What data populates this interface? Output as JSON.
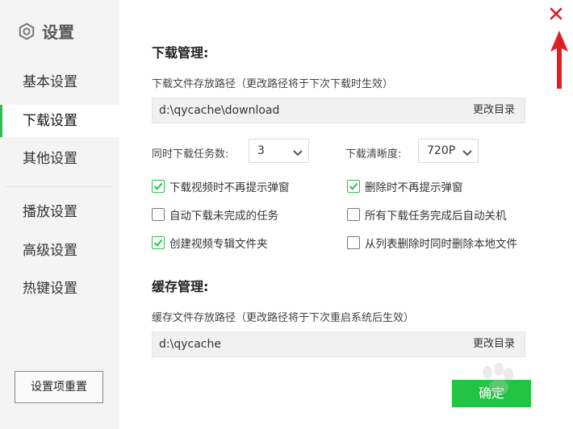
{
  "sidebar": {
    "title": "设置",
    "items": [
      {
        "label": "基本设置",
        "active": false
      },
      {
        "label": "下载设置",
        "active": true
      },
      {
        "label": "其他设置",
        "active": false
      },
      {
        "label": "播放设置",
        "active": false
      },
      {
        "label": "高级设置",
        "active": false
      },
      {
        "label": "热键设置",
        "active": false
      }
    ],
    "reset_label": "设置项重置"
  },
  "download": {
    "section_title": "下载管理:",
    "path_label": "下载文件存放路径（更改路径将于下次下载时生效）",
    "path_value": "d:\\qycache\\download",
    "change_label": "更改目录",
    "tasks_label": "同时下载任务数:",
    "tasks_value": "3",
    "quality_label": "下载清晰度:",
    "quality_value": "720P",
    "checkboxes": [
      {
        "label": "下载视频时不再提示弹窗",
        "checked": true
      },
      {
        "label": "删除时不再提示弹窗",
        "checked": true
      },
      {
        "label": "自动下载未完成的任务",
        "checked": false
      },
      {
        "label": "所有下载任务完成后自动关机",
        "checked": false
      },
      {
        "label": "创建视频专辑文件夹",
        "checked": true
      },
      {
        "label": "从列表删除时同时删除本地文件",
        "checked": false
      }
    ]
  },
  "cache": {
    "section_title": "缓存管理:",
    "path_label": "缓存文件存放路径（更改路径将于下次重启系统后生效）",
    "path_value": "d:\\qycache",
    "change_label": "更改目录"
  },
  "footer": {
    "confirm_label": "确定"
  },
  "colors": {
    "accent": "#2bbd4e",
    "close": "#cc1f1f",
    "arrow": "#e02020"
  },
  "icons": {
    "title": "gear-icon",
    "close": "close-icon",
    "dropdown": "chevron-down-icon",
    "check": "checkmark-icon"
  }
}
